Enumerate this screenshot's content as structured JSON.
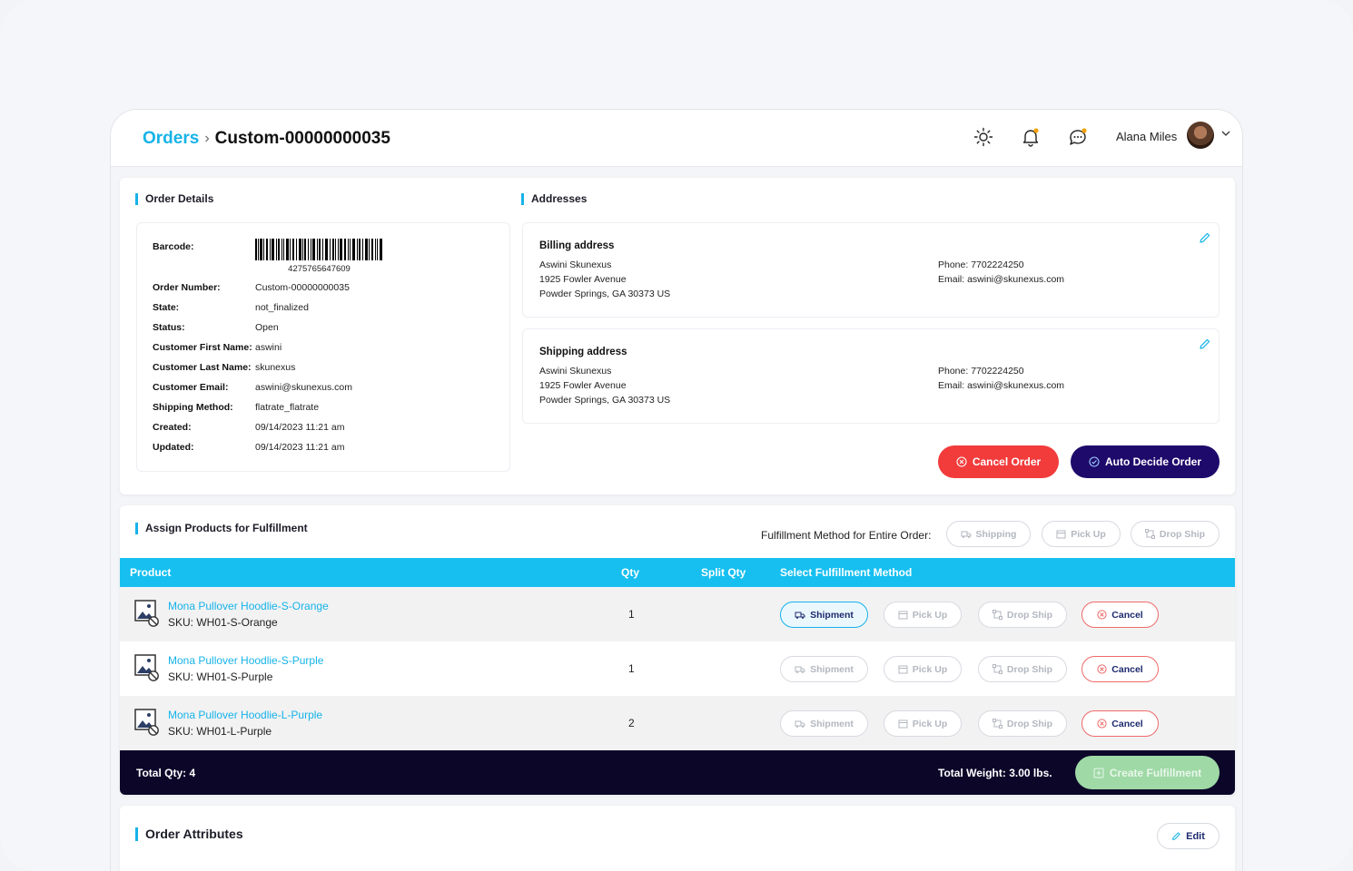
{
  "header": {
    "breadcrumb_root": "Orders",
    "breadcrumb_current": "Custom-00000000035",
    "user_name": "Alana Miles"
  },
  "order_details": {
    "title": "Order Details",
    "barcode_label": "Barcode:",
    "barcode_number": "4275765647609",
    "fields": [
      {
        "key": "Order Number:",
        "value": "Custom-00000000035"
      },
      {
        "key": "State:",
        "value": "not_finalized"
      },
      {
        "key": "Status:",
        "value": "Open"
      },
      {
        "key": "Customer First Name:",
        "value": "aswini"
      },
      {
        "key": "Customer Last Name:",
        "value": "skunexus"
      },
      {
        "key": "Customer Email:",
        "value": "aswini@skunexus.com"
      },
      {
        "key": "Shipping Method:",
        "value": "flatrate_flatrate"
      },
      {
        "key": "Created:",
        "value": "09/14/2023 11:21 am"
      },
      {
        "key": "Updated:",
        "value": "09/14/2023 11:21 am"
      }
    ]
  },
  "addresses": {
    "title": "Addresses",
    "billing": {
      "title": "Billing address",
      "name": "Aswini Skunexus",
      "street": "1925 Fowler Avenue",
      "city": "Powder Springs, GA 30373 US",
      "phone": "Phone: 7702224250",
      "email": "Email: aswini@skunexus.com"
    },
    "shipping": {
      "title": "Shipping address",
      "name": "Aswini Skunexus",
      "street": "1925 Fowler Avenue",
      "city": "Powder Springs, GA 30373 US",
      "phone": "Phone: 7702224250",
      "email": "Email: aswini@skunexus.com"
    },
    "cancel_order_label": "Cancel Order",
    "auto_decide_label": "Auto Decide Order"
  },
  "fulfillment": {
    "title": "Assign Products for Fulfillment",
    "method_label": "Fulfillment Method for Entire Order:",
    "method_buttons": [
      "Shipping",
      "Pick Up",
      "Drop Ship"
    ],
    "columns": [
      "Product",
      "Qty",
      "Split Qty",
      "Select Fulfillment Method"
    ],
    "row_buttons": {
      "shipment": "Shipment",
      "pickup": "Pick Up",
      "dropship": "Drop Ship",
      "cancel": "Cancel"
    },
    "rows": [
      {
        "name": "Mona Pullover Hoodlie-S-Orange",
        "sku": "SKU: WH01-S-Orange",
        "qty": "1"
      },
      {
        "name": "Mona Pullover Hoodlie-S-Purple",
        "sku": "SKU: WH01-S-Purple",
        "qty": "1"
      },
      {
        "name": "Mona Pullover Hoodlie-L-Purple",
        "sku": "SKU: WH01-L-Purple",
        "qty": "2"
      }
    ],
    "total_qty": "Total Qty: 4",
    "total_weight": "Total Weight: 3.00 lbs.",
    "create_label": "Create Fulfillment"
  },
  "attributes": {
    "title": "Order Attributes",
    "edit_label": "Edit"
  },
  "colors": {
    "accent": "#16b3e8",
    "danger": "#f23b3b",
    "navy": "#1e0a6b",
    "footer": "#0c0629"
  }
}
